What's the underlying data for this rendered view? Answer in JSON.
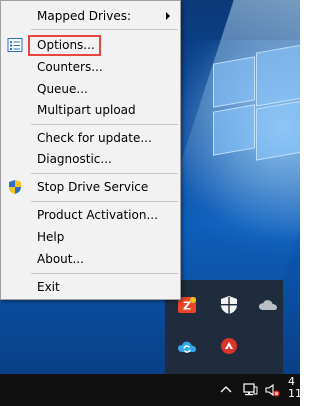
{
  "menu": {
    "items": [
      {
        "label": "Mapped Drives:",
        "has_submenu": true
      },
      {
        "label": "Options...",
        "icon": "options-checklist-icon",
        "highlighted": true
      },
      {
        "label": "Counters..."
      },
      {
        "label": "Queue..."
      },
      {
        "label": "Multipart upload"
      },
      {
        "label": "Check for update..."
      },
      {
        "label": "Diagnostic..."
      },
      {
        "label": "Stop Drive Service",
        "icon": "uac-shield-icon"
      },
      {
        "label": "Product Activation..."
      },
      {
        "label": "Help"
      },
      {
        "label": "About..."
      },
      {
        "label": "Exit"
      }
    ]
  },
  "tray_icons": [
    "zoho-z-icon",
    "windows-defender-shield-icon",
    "cloud-grey-icon",
    "cloud-sync-icon",
    "red-circle-app-icon"
  ],
  "taskbar": {
    "icons": [
      "show-hidden-icons-chevron",
      "network-icon",
      "volume-muted-icon"
    ],
    "clock_partial": [
      "4",
      "11"
    ]
  },
  "colors": {
    "highlight_border": "#e8453c",
    "menu_bg": "#f2f2f2",
    "taskbar_bg": "#101010",
    "tray_bg": "#1f2c3d"
  }
}
